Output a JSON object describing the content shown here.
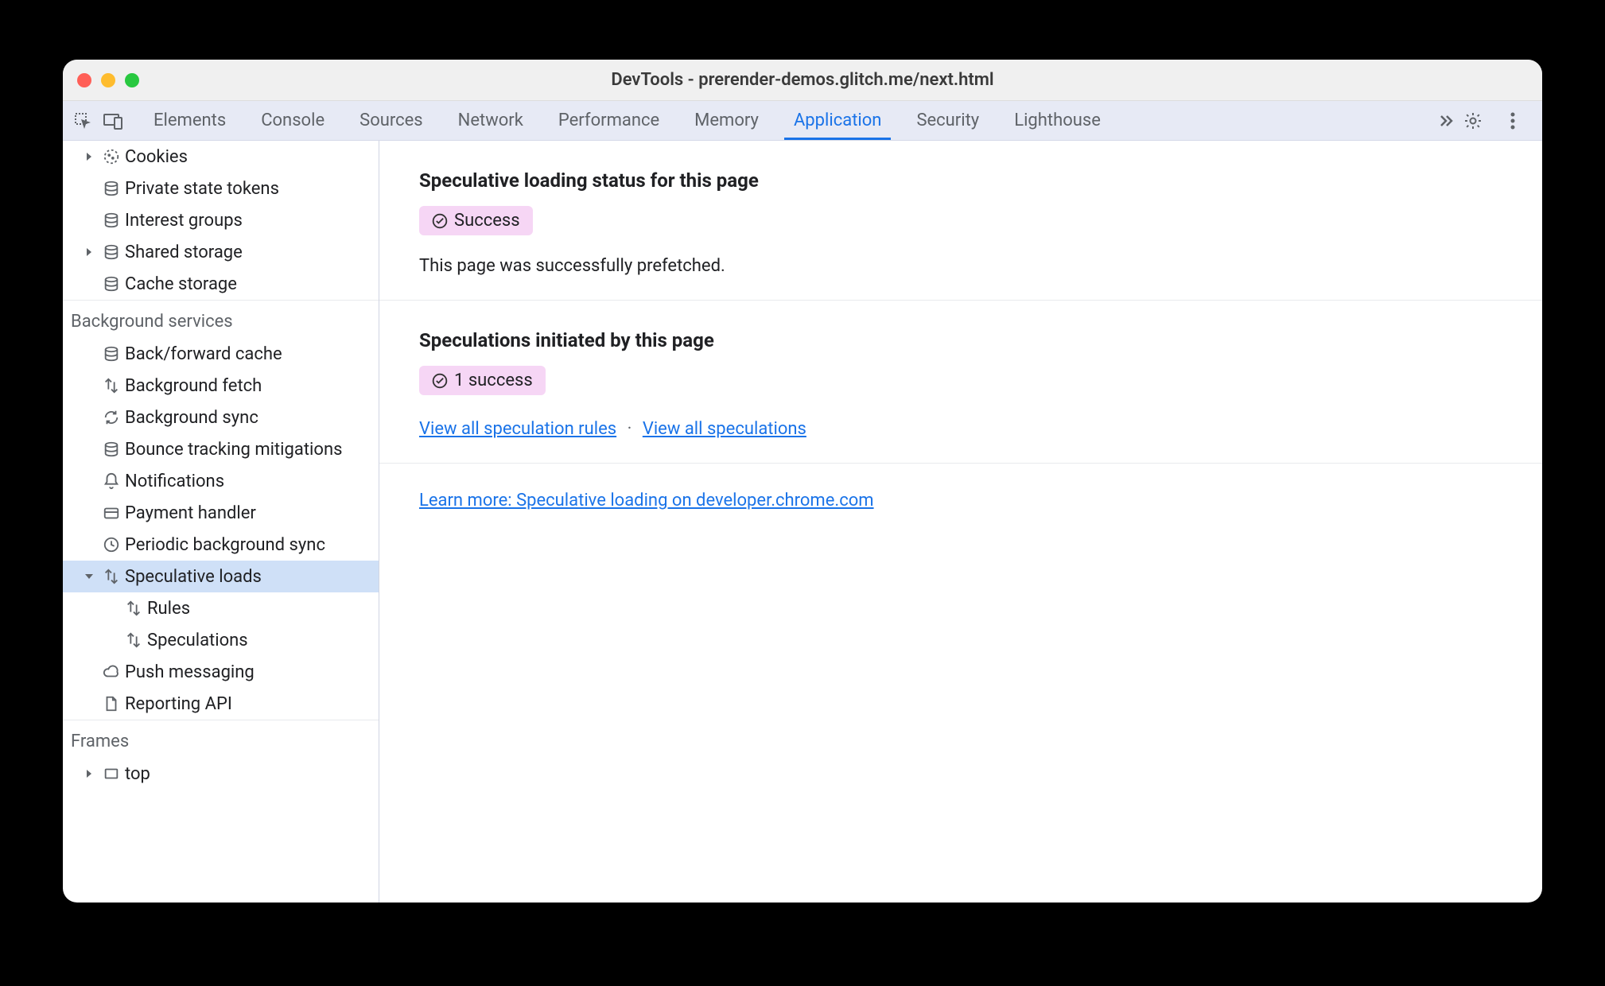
{
  "window": {
    "title": "DevTools - prerender-demos.glitch.me/next.html"
  },
  "tabs": [
    {
      "label": "Elements",
      "active": false
    },
    {
      "label": "Console",
      "active": false
    },
    {
      "label": "Sources",
      "active": false
    },
    {
      "label": "Network",
      "active": false
    },
    {
      "label": "Performance",
      "active": false
    },
    {
      "label": "Memory",
      "active": false
    },
    {
      "label": "Application",
      "active": true
    },
    {
      "label": "Security",
      "active": false
    },
    {
      "label": "Lighthouse",
      "active": false
    }
  ],
  "sidebar": {
    "storage": [
      {
        "label": "Cookies",
        "icon": "cookie",
        "arrow": "right"
      },
      {
        "label": "Private state tokens",
        "icon": "db",
        "arrow": "none"
      },
      {
        "label": "Interest groups",
        "icon": "db",
        "arrow": "none"
      },
      {
        "label": "Shared storage",
        "icon": "db",
        "arrow": "right"
      },
      {
        "label": "Cache storage",
        "icon": "db",
        "arrow": "none"
      }
    ],
    "bg_title": "Background services",
    "bg": [
      {
        "label": "Back/forward cache",
        "icon": "db",
        "arrow": "none"
      },
      {
        "label": "Background fetch",
        "icon": "updown",
        "arrow": "none"
      },
      {
        "label": "Background sync",
        "icon": "sync",
        "arrow": "none"
      },
      {
        "label": "Bounce tracking mitigations",
        "icon": "db",
        "arrow": "none"
      },
      {
        "label": "Notifications",
        "icon": "bell",
        "arrow": "none"
      },
      {
        "label": "Payment handler",
        "icon": "card",
        "arrow": "none"
      },
      {
        "label": "Periodic background sync",
        "icon": "clock",
        "arrow": "none"
      },
      {
        "label": "Speculative loads",
        "icon": "updown",
        "arrow": "down",
        "selected": true,
        "children": [
          {
            "label": "Rules",
            "icon": "updown"
          },
          {
            "label": "Speculations",
            "icon": "updown"
          }
        ]
      },
      {
        "label": "Push messaging",
        "icon": "cloud",
        "arrow": "none"
      },
      {
        "label": "Reporting API",
        "icon": "file",
        "arrow": "none"
      }
    ],
    "frames_title": "Frames",
    "frames": [
      {
        "label": "top",
        "icon": "frame",
        "arrow": "right"
      }
    ]
  },
  "main": {
    "status": {
      "heading": "Speculative loading status for this page",
      "badge": "Success",
      "text": "This page was successfully prefetched."
    },
    "initiated": {
      "heading": "Speculations initiated by this page",
      "badge": "1 success",
      "link_rules": "View all speculation rules",
      "link_specs": "View all speculations",
      "sep": "·"
    },
    "learn_more": "Learn more: Speculative loading on developer.chrome.com"
  }
}
